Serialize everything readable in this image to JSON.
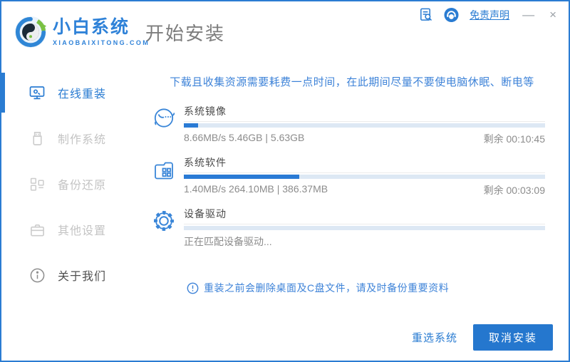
{
  "brand": {
    "name": "小白系统",
    "domain": "XIAOBAIXITONG.COM"
  },
  "header": {
    "page_title": "开始安装",
    "disclaimer_link": "免责声明",
    "minimize_label": "—",
    "close_label": "×"
  },
  "sidebar": {
    "items": [
      {
        "label": "在线重装",
        "icon": "monitor-icon",
        "state": "active"
      },
      {
        "label": "制作系统",
        "icon": "usb-icon",
        "state": "disabled"
      },
      {
        "label": "备份还原",
        "icon": "backup-blocks-icon",
        "state": "disabled"
      },
      {
        "label": "其他设置",
        "icon": "toolbox-icon",
        "state": "disabled"
      },
      {
        "label": "关于我们",
        "icon": "info-icon",
        "state": "normal"
      }
    ]
  },
  "main": {
    "warning": "下载且收集资源需要耗费一点时间，在此期间尽量不要使电脑休眠、断电等",
    "tasks": [
      {
        "title": "系统镜像",
        "icon": "mascot-face-icon",
        "stats": "8.66MB/s 5.46GB | 5.63GB",
        "remaining": "剩余 00:10:45",
        "progress_percent": 4
      },
      {
        "title": "系统软件",
        "icon": "folder-apps-icon",
        "stats": "1.40MB/s 264.10MB | 386.37MB",
        "remaining": "剩余 00:03:09",
        "progress_percent": 32
      },
      {
        "title": "设备驱动",
        "icon": "gear-icon",
        "stats": "正在匹配设备驱动...",
        "remaining": "",
        "progress_percent": 0
      }
    ],
    "notice": "重装之前会删除桌面及C盘文件，请及时备份重要资料",
    "buttons": {
      "reselect": "重选系统",
      "cancel": "取消安装"
    }
  },
  "colors": {
    "accent": "#2a7cd2",
    "button_primary": "#2577ce",
    "progress_fill": "#2a7bd5",
    "progress_track": "#dde8f4",
    "warning_text": "#3e83d8",
    "disabled_text": "#c4c4c4",
    "brand_green": "#7ac143"
  }
}
